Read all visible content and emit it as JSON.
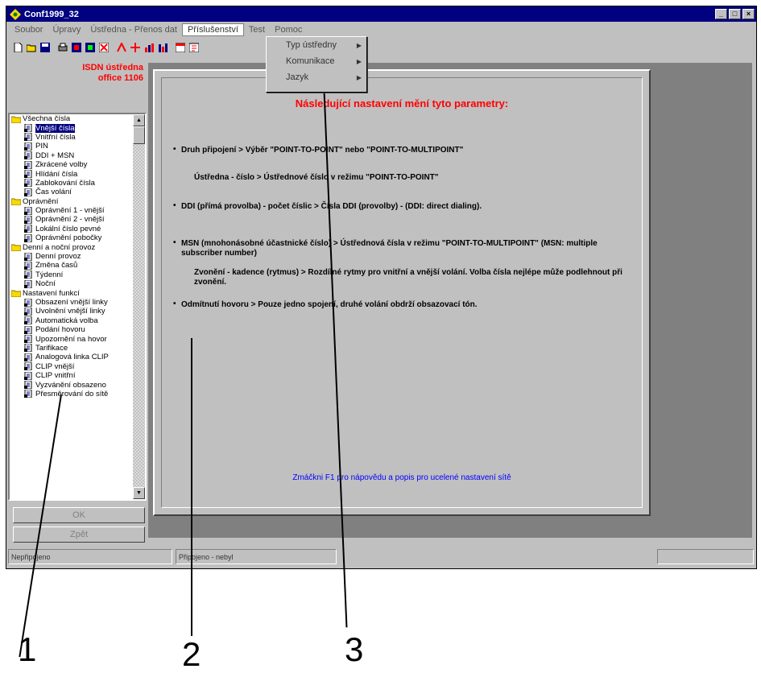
{
  "window": {
    "title": "Conf1999_32"
  },
  "menubar": {
    "items": [
      "Soubor",
      "Úpravy",
      "Ústředna - Přenos dat",
      "Příslušenství",
      "Test",
      "Pomoc"
    ],
    "active_index": 3
  },
  "dropdown": {
    "items": [
      "Typ ústředny",
      "Komunikace",
      "Jazyk"
    ]
  },
  "toolbar": {
    "buttons": [
      "new-icon",
      "open-icon",
      "save-icon",
      "print-icon",
      "read-icon",
      "write-icon",
      "reset-icon",
      "test-icon",
      "connect-icon",
      "chart-icon",
      "chart2-icon",
      "calendar-icon",
      "cost-icon"
    ],
    "help_icon": "help-icon"
  },
  "left_panel": {
    "title_line1": "ISDN ústředna",
    "title_line2": "office 1106",
    "tree": [
      {
        "label": "Všechna čísla",
        "level": 0,
        "type": "folder"
      },
      {
        "label": "Vnější čísla",
        "level": 1,
        "type": "item",
        "selected": true
      },
      {
        "label": "Vnitřní čísla",
        "level": 1,
        "type": "item"
      },
      {
        "label": "PIN",
        "level": 1,
        "type": "item"
      },
      {
        "label": "DDI + MSN",
        "level": 1,
        "type": "item"
      },
      {
        "label": "Zkrácené volby",
        "level": 1,
        "type": "item"
      },
      {
        "label": "Hlídání čísla",
        "level": 1,
        "type": "item"
      },
      {
        "label": "Zablokování čísla",
        "level": 1,
        "type": "item"
      },
      {
        "label": "Čas volání",
        "level": 1,
        "type": "item"
      },
      {
        "label": "Oprávnění",
        "level": 0,
        "type": "folder"
      },
      {
        "label": "Oprávnění 1 - vnější",
        "level": 1,
        "type": "item"
      },
      {
        "label": "Oprávnění 2 - vnější",
        "level": 1,
        "type": "item"
      },
      {
        "label": "Lokální číslo pevné",
        "level": 1,
        "type": "item"
      },
      {
        "label": "Oprávnění pobočky",
        "level": 1,
        "type": "item"
      },
      {
        "label": "Denní a noční provoz",
        "level": 0,
        "type": "folder"
      },
      {
        "label": "Denní provoz",
        "level": 1,
        "type": "item"
      },
      {
        "label": "Změna časů",
        "level": 1,
        "type": "item"
      },
      {
        "label": "Týdenní",
        "level": 1,
        "type": "item"
      },
      {
        "label": "Noční",
        "level": 1,
        "type": "item"
      },
      {
        "label": "Nastavení funkcí",
        "level": 0,
        "type": "folder"
      },
      {
        "label": "Obsazení vnější linky",
        "level": 1,
        "type": "item"
      },
      {
        "label": "Uvolnění vnější linky",
        "level": 1,
        "type": "item"
      },
      {
        "label": "Automatická volba",
        "level": 1,
        "type": "item"
      },
      {
        "label": "Podání hovoru",
        "level": 1,
        "type": "item"
      },
      {
        "label": "Upozornění na hovor",
        "level": 1,
        "type": "item"
      },
      {
        "label": "Tarifikace",
        "level": 1,
        "type": "item"
      },
      {
        "label": "Analogová linka CLIP",
        "level": 1,
        "type": "item"
      },
      {
        "label": "CLIP vnější",
        "level": 1,
        "type": "item"
      },
      {
        "label": "CLIP vnitřní",
        "level": 1,
        "type": "item"
      },
      {
        "label": "Vyzvánění obsazeno",
        "level": 1,
        "type": "item"
      },
      {
        "label": "Přesměrování do sítě",
        "level": 1,
        "type": "item"
      }
    ],
    "ok_button": "OK",
    "cancel_button": "Zpět"
  },
  "content": {
    "heading": "Následující nastavení mění tyto parametry:",
    "p1": "Druh připojení > Výběr \"POINT-TO-POINT\" nebo \"POINT-TO-MULTIPOINT\"",
    "p2": "Ústředna - číslo > Ústřednové číslo v režimu \"POINT-TO-POINT\"",
    "p3": "DDI (přímá provolba) - počet číslic > Čísla DDI (provolby) - (DDI: direct dialing).",
    "p4": "MSN (mnohonásobné účastnické číslo) > Ústřednová čísla v režimu \"POINT-TO-MULTIPOINT\" (MSN: multiple subscriber number)",
    "p5": "Zvonění - kadence (rytmus) > Rozdílné rytmy pro vnitřní a vnější volání. Volba čísla nejlépe může podlehnout při zvonění.",
    "p6": "Odmítnutí hovoru > Pouze jedno spojení, druhé volání obdrží obsazovací tón.",
    "footer_link": "Zmáčkni F1 pro nápovědu a popis pro ucelené nastavení sítě"
  },
  "statusbar": {
    "pane1": "Nepřipojeno",
    "pane2": "Připojeno - nebyl",
    "pane3": ""
  },
  "callouts": [
    "1",
    "2",
    "3"
  ]
}
